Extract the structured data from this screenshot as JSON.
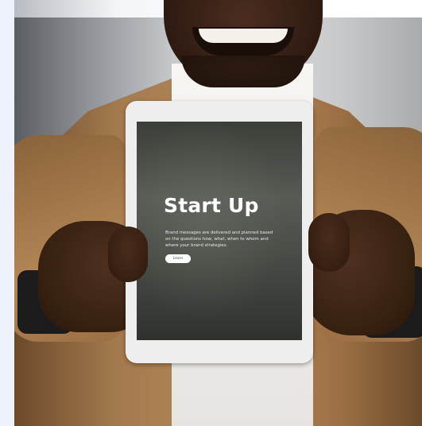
{
  "tablet": {
    "title": "Start Up",
    "body": "Brand messages are delivered and planned based on the questions how, what, when to whom and where your brand strategies.",
    "button_label": "Learn"
  }
}
